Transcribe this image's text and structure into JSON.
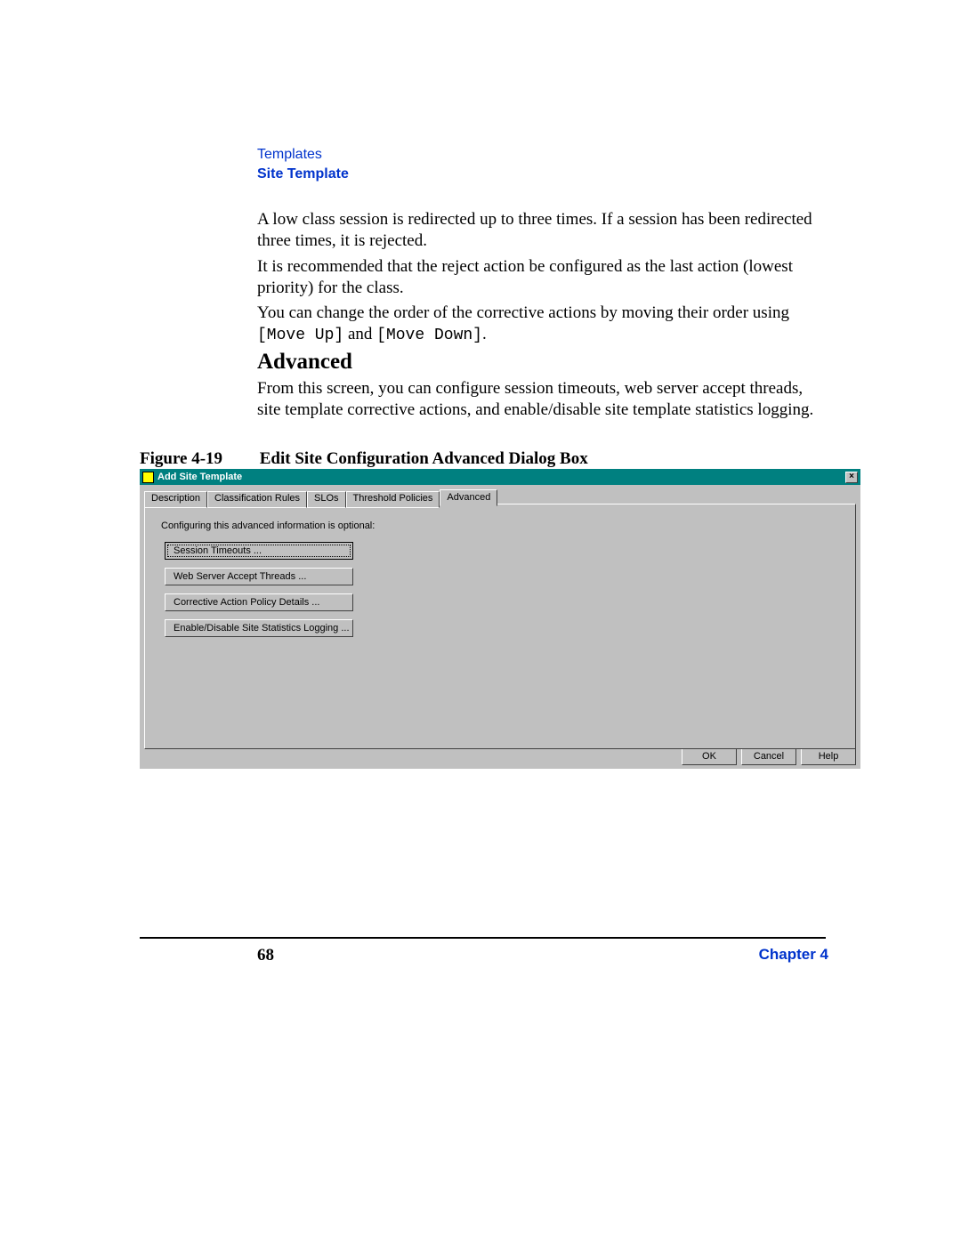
{
  "header": {
    "category": "Templates",
    "section": "Site Template"
  },
  "paragraphs": {
    "p1": "A low class session is redirected up to three times. If a session has been redirected three times, it is rejected.",
    "p2": "It is recommended that the reject action be configured as the last action (lowest priority) for the class.",
    "p3_a": "You can change the order of the corrective actions by moving their order using ",
    "p3_m1": "[Move Up]",
    "p3_b": " and ",
    "p3_m2": "[Move Down]",
    "p3_c": "."
  },
  "heading_advanced": "Advanced",
  "paragraph_advanced": "From this screen, you can configure session timeouts, web server accept threads, site template corrective actions, and enable/disable site template statistics logging.",
  "figure": {
    "label": "Figure 4-19",
    "title": "Edit Site Configuration Advanced Dialog Box"
  },
  "dialog": {
    "title": "Add Site Template",
    "close_glyph": "×",
    "tabs": {
      "description": "Description",
      "classification_rules": "Classification Rules",
      "slos": "SLOs",
      "threshold_policies": "Threshold Policies",
      "advanced": "Advanced"
    },
    "panel_text": "Configuring this advanced information is optional:",
    "buttons": {
      "session_timeouts": "Session Timeouts ...",
      "web_server_accept_threads": "Web Server Accept Threads ...",
      "corrective_action_policy": "Corrective Action Policy Details ...",
      "site_stats_logging": "Enable/Disable Site Statistics Logging ..."
    },
    "footer_buttons": {
      "ok": "OK",
      "cancel": "Cancel",
      "help": "Help"
    }
  },
  "footer": {
    "page": "68",
    "chapter": "Chapter 4"
  }
}
